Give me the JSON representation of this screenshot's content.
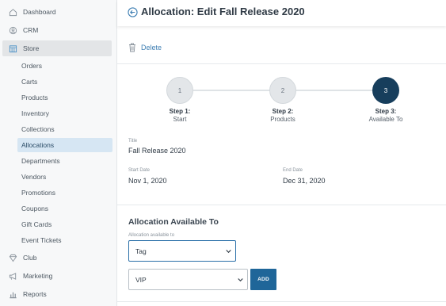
{
  "sidebar": {
    "items": [
      {
        "label": "Dashboard",
        "icon": "dashboard-icon"
      },
      {
        "label": "CRM",
        "icon": "crm-icon"
      },
      {
        "label": "Store",
        "icon": "store-icon"
      },
      {
        "label": "Club",
        "icon": "club-icon"
      },
      {
        "label": "Marketing",
        "icon": "marketing-icon"
      },
      {
        "label": "Reports",
        "icon": "reports-icon"
      }
    ],
    "store_subitems": [
      "Orders",
      "Carts",
      "Products",
      "Inventory",
      "Collections",
      "Allocations",
      "Departments",
      "Vendors",
      "Promotions",
      "Coupons",
      "Gift Cards",
      "Event Tickets"
    ],
    "active_subitem": "Allocations"
  },
  "header": {
    "title_prefix": "Allocation:",
    "title_main": "Edit Fall Release 2020"
  },
  "actions": {
    "delete_label": "Delete"
  },
  "stepper": {
    "steps": [
      {
        "number": "1",
        "title": "Step 1:",
        "subtitle": "Start",
        "state": "inactive"
      },
      {
        "number": "2",
        "title": "Step 2:",
        "subtitle": "Products",
        "state": "inactive"
      },
      {
        "number": "3",
        "title": "Step 3:",
        "subtitle": "Available To",
        "state": "current"
      }
    ]
  },
  "details": {
    "title_label": "Title",
    "title_value": "Fall Release 2020",
    "start_label": "Start Date",
    "start_value": "Nov 1, 2020",
    "end_label": "End Date",
    "end_value": "Dec 31, 2020"
  },
  "availability": {
    "section_title": "Allocation Available To",
    "select_label": "Allocation available to",
    "type_value": "Tag",
    "tag_value": "VIP",
    "add_label": "ADD"
  },
  "colors": {
    "accent": "#1f6699",
    "active_step": "#173e5c",
    "active_nav": "#d6e6f3",
    "link": "#3f7fb3"
  }
}
